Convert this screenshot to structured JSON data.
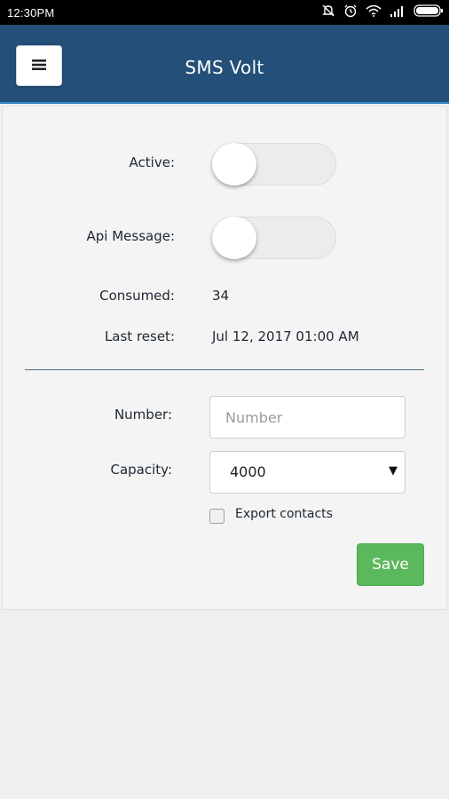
{
  "status_bar": {
    "time": "12:30PM",
    "icons": [
      "mute-icon",
      "alarm-icon",
      "wifi-icon",
      "signal-icon",
      "battery-icon"
    ]
  },
  "header": {
    "title": "SMS Volt",
    "menu_icon": "hamburger-menu-icon",
    "background": "#234f78"
  },
  "settings": {
    "active_label": "Active:",
    "active_on": false,
    "api_message_label": "Api Message:",
    "api_message_on": false,
    "consumed_label": "Consumed:",
    "consumed_value": "34",
    "last_reset_label": "Last reset:",
    "last_reset_value": "Jul 12, 2017 01:00 AM"
  },
  "form": {
    "number_label": "Number:",
    "number_value": "",
    "number_placeholder": "Number",
    "capacity_label": "Capacity:",
    "capacity_value": "4000",
    "export_contacts_label": "Export contacts",
    "export_contacts_checked": false,
    "save_label": "Save",
    "save_color": "#5cb85c"
  }
}
